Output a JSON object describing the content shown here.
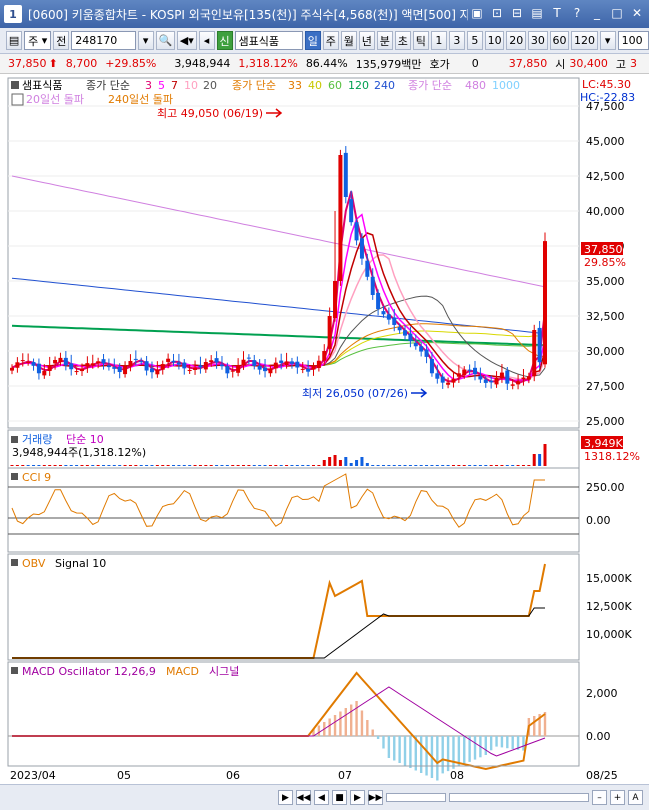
{
  "window": {
    "badge": "1",
    "title": "[0600] 키움종합차트 - KOSPI 외국인보유[135(천)] 주식수[4,568(천)] 액면[500] 자",
    "buttons": [
      "▣",
      "⊡",
      "⊟",
      "▤",
      "T",
      "?",
      "_",
      "□",
      "✕"
    ]
  },
  "toolbar": {
    "market": "주",
    "prefix": "전",
    "code": "248170",
    "stock_badge": "신",
    "stock_name": "샘표식품",
    "periods": [
      "일",
      "주",
      "월",
      "년",
      "분",
      "초",
      "틱"
    ],
    "intervals": [
      "1",
      "3",
      "5",
      "10",
      "20",
      "30",
      "60",
      "120"
    ],
    "count": "100"
  },
  "quote": {
    "price": "37,850",
    "change": "8,700",
    "change_pct": "+29.85%",
    "volume": "3,948,944",
    "vol_pct": "1,318.12%",
    "rate": "86.44%",
    "amount": "135,979백만",
    "ask_label": "호가",
    "ask_value": "0",
    "price2": "37,850",
    "open_label": "시",
    "open_value": "30,400",
    "high_label": "고",
    "high_value": "3"
  },
  "price_panel": {
    "legend": {
      "stock": "샘표식품",
      "ma_label": "종가 단순",
      "ma_short": [
        "3",
        "5",
        "7",
        "10",
        "20"
      ],
      "ma_mid_label": "종가 단순",
      "ma_mid": [
        "33",
        "40",
        "60",
        "120",
        "240"
      ],
      "ma_long_label": "종가 단순",
      "ma_long": [
        "480",
        "1000"
      ],
      "signal1": "20일선 돌파",
      "signal2": "240일선 돌파"
    },
    "high_note": "최고 49,050 (06/19)",
    "low_note": "최저 26,050 (07/26)",
    "lc": "LC:45.30",
    "hc": "HC:-22.83",
    "last_price": "37,850",
    "last_pct": "29.85%",
    "y_ticks": [
      "47,500",
      "45,000",
      "42,500",
      "40,000",
      "37,500",
      "35,000",
      "32,500",
      "30,000",
      "27,500",
      "25,000"
    ]
  },
  "volume_panel": {
    "legend": "거래량",
    "ma_label": "단순 10",
    "info": "3,948,944주(1,318.12%)",
    "last": "3,949K",
    "last_pct": "1318.12%"
  },
  "cci_panel": {
    "legend": "CCI 9",
    "y_ticks": [
      "250.00",
      "0.00"
    ]
  },
  "obv_panel": {
    "legend": "OBV",
    "signal": "Signal 10",
    "y_ticks": [
      "15,000K",
      "12,500K",
      "10,000K"
    ]
  },
  "macd_panel": {
    "legend": "MACD Oscillator 12,26,9",
    "macd": "MACD",
    "signal": "시그널",
    "y_ticks": [
      "2,000",
      "0.00"
    ]
  },
  "x_axis": {
    "labels": [
      "2023/04",
      "05",
      "06",
      "07",
      "08",
      "08/25"
    ]
  },
  "status_buttons": [
    "▶",
    "◀◀",
    "◀",
    "■",
    "▶",
    "▶▶",
    "–",
    "+",
    "A"
  ],
  "colors": {
    "up": "#e00000",
    "down": "#1060e0",
    "ma3": "#e00070",
    "ma5": "#ff00ff",
    "ma7": "#c00000",
    "ma10": "#ffa0c0",
    "ma20": "#555555",
    "ma33": "#e07a00",
    "ma40": "#d8d800",
    "ma60": "#58c040",
    "ma120": "#00a050",
    "ma240": "#2050d0",
    "ma480": "#d080e0",
    "ma1000": "#80d0ff"
  },
  "chart_data": {
    "type": "candlestick",
    "x_range": [
      "2023/04",
      "08/25"
    ],
    "price_range": [
      24500,
      49500
    ],
    "highest": {
      "value": 49050,
      "date": "06/19"
    },
    "lowest": {
      "value": 26050,
      "date": "07/26"
    },
    "last": 37850
  }
}
